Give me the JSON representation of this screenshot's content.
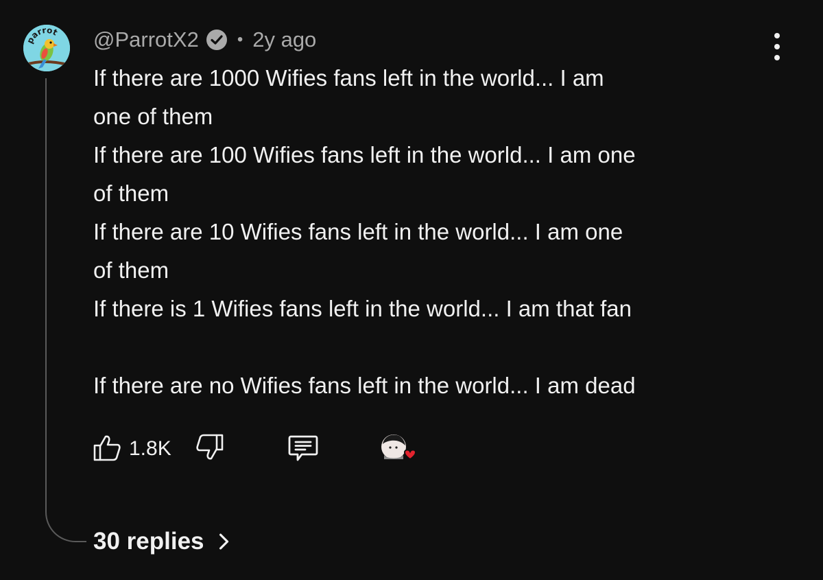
{
  "comment": {
    "author": "@ParrotX2",
    "separator": "•",
    "time": "2y ago",
    "lines": [
      "If there are 1000 Wifies fans left in the world... I am",
      "one of them",
      "If there are 100 Wifies fans left in the world... I am one",
      "of them",
      "If there are 10 Wifies fans left in the world... I am one",
      "of them",
      "If there is 1 Wifies fans left in the world... I am that fan",
      "",
      "If there are no Wifies fans left in the world... I am dead"
    ],
    "like_count": "1.8K",
    "replies_label": "30 replies"
  },
  "avatar_text": "parrot",
  "icons": {
    "verified": "verified-check-icon",
    "more": "more-vertical-icon",
    "like": "thumbs-up-icon",
    "dislike": "thumbs-down-icon",
    "reply": "comment-icon",
    "creator_heart": "creator-heart-icon",
    "chevron": "chevron-right-icon"
  },
  "colors": {
    "background": "#0f0f0f",
    "text": "#f1f1f1",
    "secondary_text": "#aaaaaa",
    "heart": "#e3232e"
  }
}
